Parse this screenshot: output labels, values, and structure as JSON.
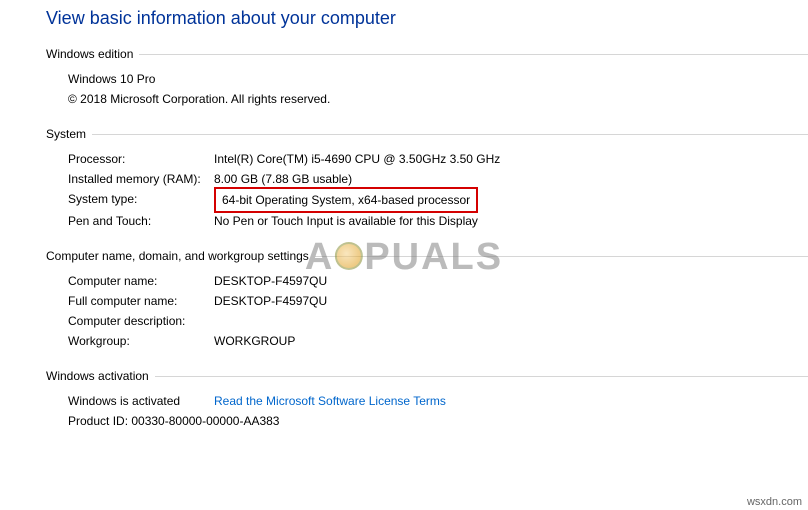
{
  "title": "View basic information about your computer",
  "sections": {
    "edition": {
      "header": "Windows edition",
      "product": "Windows 10 Pro",
      "copyright": "© 2018 Microsoft Corporation. All rights reserved."
    },
    "system": {
      "header": "System",
      "processor_label": "Processor:",
      "processor_value": "Intel(R) Core(TM) i5-4690 CPU @ 3.50GHz   3.50 GHz",
      "ram_label": "Installed memory (RAM):",
      "ram_value": "8.00 GB (7.88 GB usable)",
      "type_label": "System type:",
      "type_value": "64-bit Operating System, x64-based processor",
      "pen_label": "Pen and Touch:",
      "pen_value": "No Pen or Touch Input is available for this Display"
    },
    "domain": {
      "header": "Computer name, domain, and workgroup settings",
      "cname_label": "Computer name:",
      "cname_value": "DESKTOP-F4597QU",
      "fullname_label": "Full computer name:",
      "fullname_value": "DESKTOP-F4597QU",
      "desc_label": "Computer description:",
      "desc_value": "",
      "workgroup_label": "Workgroup:",
      "workgroup_value": "WORKGROUP"
    },
    "activation": {
      "header": "Windows activation",
      "status": "Windows is activated",
      "license_link": "Read the Microsoft Software License Terms",
      "product_id": "Product ID: 00330-80000-00000-AA383"
    }
  },
  "watermark": {
    "pre": "A",
    "post": "PUALS"
  },
  "source": "wsxdn.com"
}
